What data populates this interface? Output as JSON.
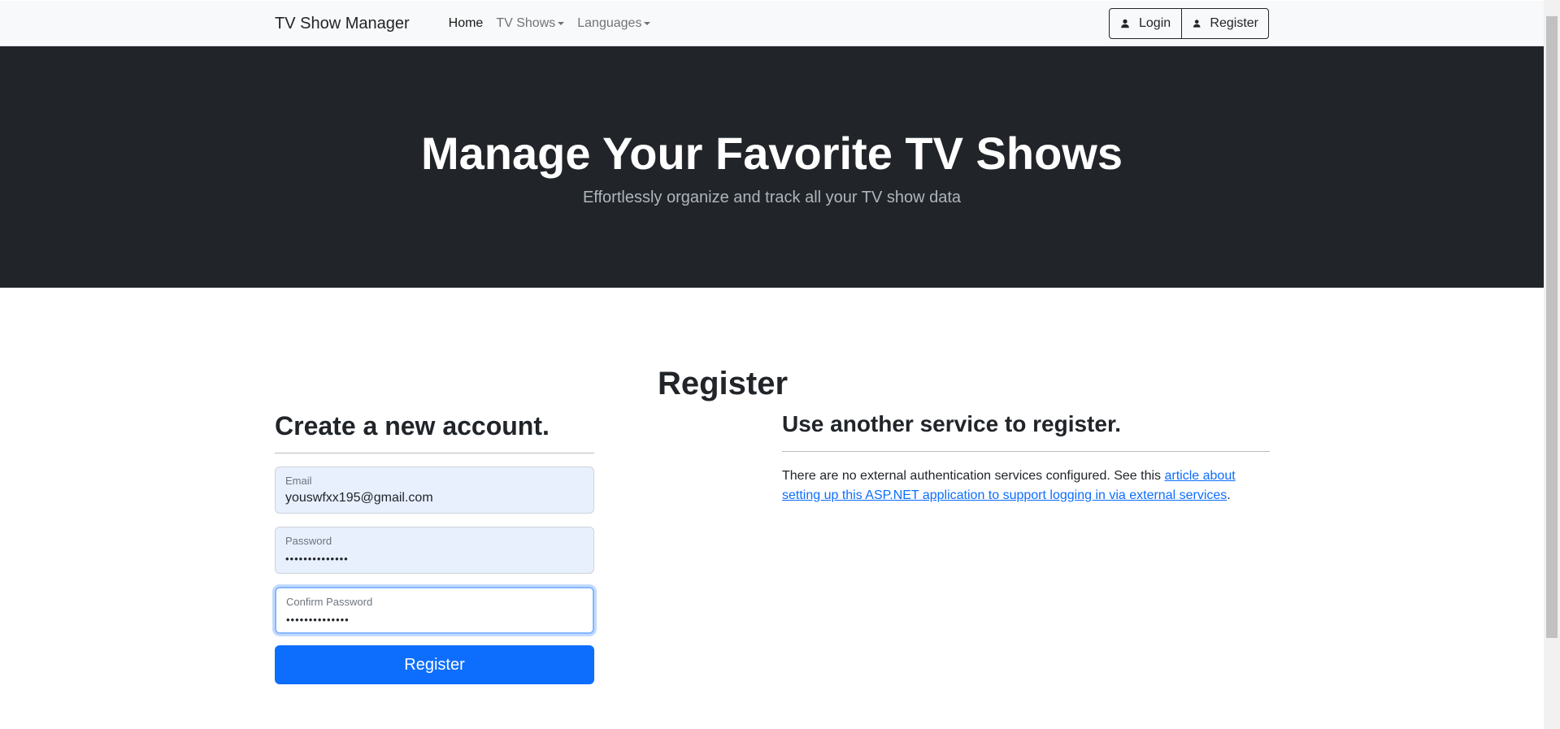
{
  "navbar": {
    "brand": "TV Show Manager",
    "links": {
      "home": "Home",
      "tv_shows": "TV Shows",
      "languages": "Languages"
    },
    "login_label": "Login",
    "register_label": "Register"
  },
  "hero": {
    "title": "Manage Your Favorite TV Shows",
    "subtitle": "Effortlessly organize and track all your TV show data"
  },
  "main": {
    "title": "Register",
    "form": {
      "heading": "Create a new account.",
      "email_label": "Email",
      "email_value": "youswfxx195@gmail.com",
      "password_label": "Password",
      "password_value": "••••••••••••••",
      "confirm_label": "Confirm Password",
      "confirm_value": "••••••••••••••",
      "submit_label": "Register"
    },
    "external": {
      "heading": "Use another service to register.",
      "text": "There are no external authentication services configured. See this ",
      "link_text": "article about setting up this ASP.NET application to support logging in via external services",
      "trailing": "."
    }
  },
  "colors": {
    "navbar_bg": "#f8f9fa",
    "hero_bg": "#212529",
    "primary": "#0d6efd",
    "autofill_bg": "#e8f0fe"
  },
  "icons": {
    "login": "user-icon",
    "register": "user-icon"
  }
}
